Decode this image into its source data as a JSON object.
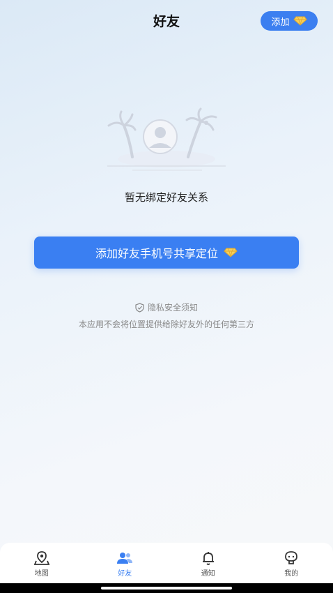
{
  "header": {
    "title": "好友",
    "add_label": "添加",
    "add_icon": "diamond-icon"
  },
  "empty_state": {
    "illustration": "island-avatar-illustration",
    "message": "暂无绑定好友关系"
  },
  "cta": {
    "label": "添加好友手机号共享定位",
    "icon": "diamond-icon"
  },
  "privacy": {
    "title": "隐私安全须知",
    "description": "本应用不会将位置提供给除好友外的任何第三方",
    "icon": "shield-check-icon"
  },
  "tabs": [
    {
      "label": "地图",
      "icon": "map-pin-icon",
      "active": false
    },
    {
      "label": "好友",
      "icon": "friends-icon",
      "active": true
    },
    {
      "label": "通知",
      "icon": "bell-icon",
      "active": false
    },
    {
      "label": "我的",
      "icon": "profile-icon",
      "active": false
    }
  ],
  "colors": {
    "accent": "#3a7ff2",
    "gem": "#f2c14e"
  }
}
